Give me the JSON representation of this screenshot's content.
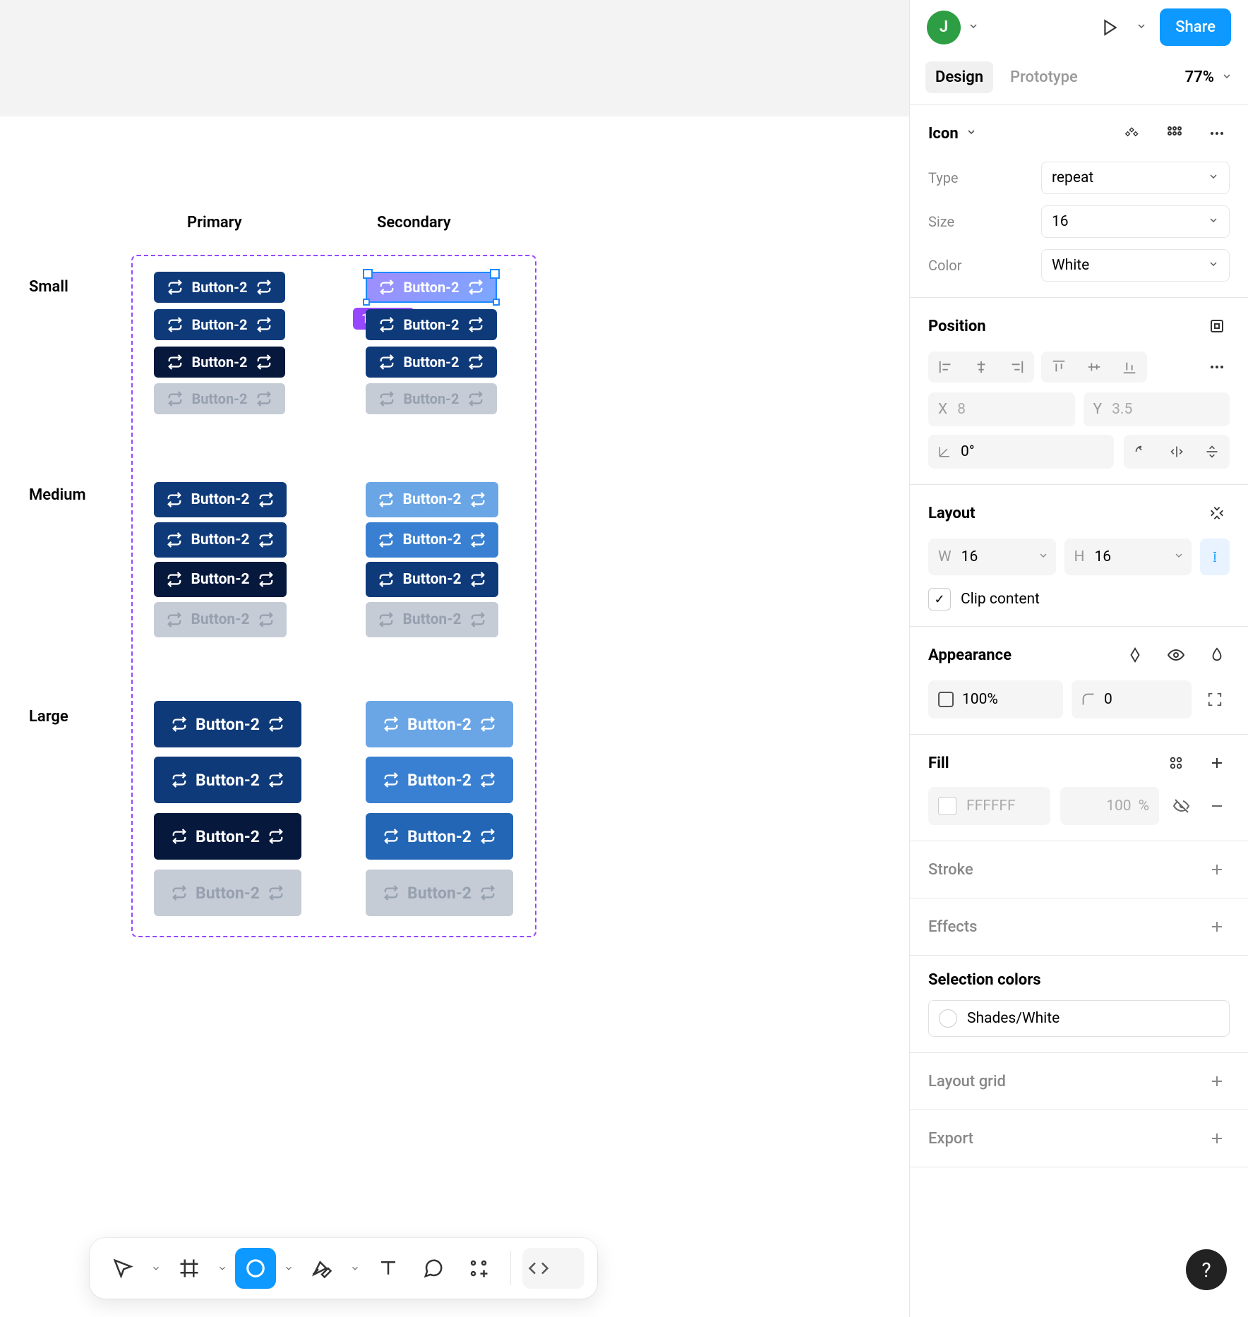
{
  "canvas": {
    "columns": {
      "primary": "Primary",
      "secondary": "Secondary"
    },
    "rows": {
      "small": "Small",
      "medium": "Medium",
      "large": "Large"
    },
    "button_label": "Button-2",
    "dim_badge": "16 × 16"
  },
  "panel": {
    "header": {
      "avatar_initial": "J",
      "share_label": "Share"
    },
    "tabs": {
      "design": "Design",
      "prototype": "Prototype",
      "zoom": "77%"
    },
    "icon_section": {
      "title": "Icon",
      "props": {
        "type_label": "Type",
        "type_value": "repeat",
        "size_label": "Size",
        "size_value": "16",
        "color_label": "Color",
        "color_value": "White"
      }
    },
    "position": {
      "title": "Position",
      "x_label": "X",
      "x_value": "8",
      "y_label": "Y",
      "y_value": "3.5",
      "rotation_value": "0°"
    },
    "layout": {
      "title": "Layout",
      "w_label": "W",
      "w_value": "16",
      "h_label": "H",
      "h_value": "16",
      "clip_label": "Clip content"
    },
    "appearance": {
      "title": "Appearance",
      "opacity_value": "100%",
      "radius_value": "0"
    },
    "fill": {
      "title": "Fill",
      "hex": "FFFFFF",
      "opacity": "100",
      "unit": "%"
    },
    "stroke": {
      "title": "Stroke"
    },
    "effects": {
      "title": "Effects"
    },
    "selection_colors": {
      "title": "Selection colors",
      "value": "Shades/White"
    },
    "layout_grid": {
      "title": "Layout grid"
    },
    "export": {
      "title": "Export"
    }
  },
  "help_label": "?"
}
